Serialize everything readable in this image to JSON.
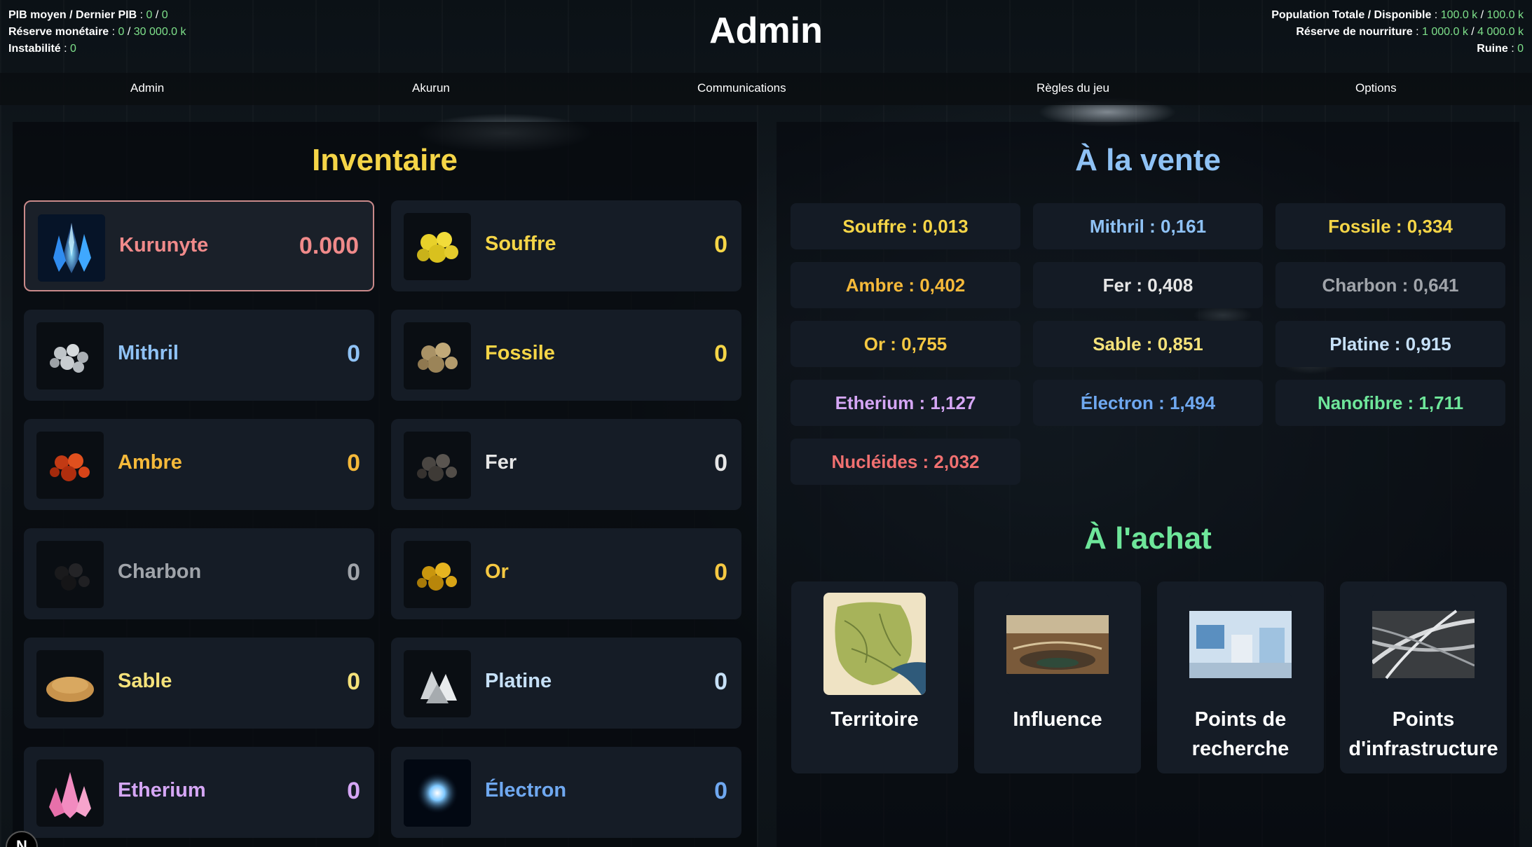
{
  "header": {
    "title": "Admin",
    "left_stats": [
      {
        "label": "PIB moyen / Dernier PIB",
        "values": [
          "0",
          "0"
        ]
      },
      {
        "label": "Réserve monétaire",
        "values": [
          "0",
          "30 000.0 k"
        ]
      },
      {
        "label": "Instabilité",
        "values": [
          "0"
        ]
      }
    ],
    "right_stats": [
      {
        "label": "Population Totale / Disponible",
        "values": [
          "100.0 k",
          "100.0 k"
        ]
      },
      {
        "label": "Réserve de nourriture",
        "values": [
          "1 000.0 k",
          "4 000.0 k"
        ]
      },
      {
        "label": "Ruine",
        "values": [
          "0"
        ]
      }
    ]
  },
  "nav": [
    "Admin",
    "Akurun",
    "Communications",
    "Règles du jeu",
    "Options"
  ],
  "inventory": {
    "title": "Inventaire",
    "items": [
      {
        "name": "Kurunyte",
        "qty": "0.000",
        "color": "#f08a8a",
        "icon": "kurunyte-crystal-icon"
      },
      {
        "name": "Souffre",
        "qty": "0",
        "color": "#f5d547",
        "icon": "souffre-icon"
      },
      {
        "name": "Mithril",
        "qty": "0",
        "color": "#8fc2f5",
        "icon": "mithril-icon"
      },
      {
        "name": "Fossile",
        "qty": "0",
        "color": "#f5d547",
        "icon": "fossile-icon"
      },
      {
        "name": "Ambre",
        "qty": "0",
        "color": "#f5b93a",
        "icon": "ambre-icon"
      },
      {
        "name": "Fer",
        "qty": "0",
        "color": "#e6e6e6",
        "icon": "fer-icon"
      },
      {
        "name": "Charbon",
        "qty": "0",
        "color": "#a0a4aa",
        "icon": "charbon-icon"
      },
      {
        "name": "Or",
        "qty": "0",
        "color": "#f5c842",
        "icon": "or-icon"
      },
      {
        "name": "Sable",
        "qty": "0",
        "color": "#f5e27a",
        "icon": "sable-icon"
      },
      {
        "name": "Platine",
        "qty": "0",
        "color": "#c6e0f7",
        "icon": "platine-icon"
      },
      {
        "name": "Etherium",
        "qty": "0",
        "color": "#d5a6f5",
        "icon": "etherium-icon"
      },
      {
        "name": "Électron",
        "qty": "0",
        "color": "#6fa8f0",
        "icon": "electron-icon"
      }
    ]
  },
  "sale": {
    "title": "À la vente",
    "items": [
      {
        "label": "Souffre : 0,013",
        "color": "#f5d547"
      },
      {
        "label": "Mithril : 0,161",
        "color": "#8fc2f5"
      },
      {
        "label": "Fossile : 0,334",
        "color": "#f5d547"
      },
      {
        "label": "Ambre : 0,402",
        "color": "#f5b93a"
      },
      {
        "label": "Fer : 0,408",
        "color": "#e6e6e6"
      },
      {
        "label": "Charbon : 0,641",
        "color": "#a0a4aa"
      },
      {
        "label": "Or : 0,755",
        "color": "#f5c842"
      },
      {
        "label": "Sable : 0,851",
        "color": "#f5e27a"
      },
      {
        "label": "Platine : 0,915",
        "color": "#c6e0f7"
      },
      {
        "label": "Etherium : 1,127",
        "color": "#d5a6f5"
      },
      {
        "label": "Électron : 1,494",
        "color": "#6fa8f0"
      },
      {
        "label": "Nanofibre : 1,711",
        "color": "#6ee69a"
      },
      {
        "label": "Nucléides : 2,032",
        "color": "#f07070"
      }
    ]
  },
  "purchase": {
    "title": "À l'achat",
    "items": [
      {
        "label": "Territoire",
        "icon": "territory-map-icon"
      },
      {
        "label": "Influence",
        "icon": "parliament-icon"
      },
      {
        "label": "Points de recherche",
        "icon": "laboratory-icon"
      },
      {
        "label": "Points d'infrastructure",
        "icon": "highway-icon"
      }
    ]
  },
  "colors": {
    "inventory_title": "#f5d547",
    "sale_title": "#8fc2f5",
    "purchase_title": "#6ee69a",
    "stat_value": "#7ee08a"
  },
  "corner_badge": "N"
}
